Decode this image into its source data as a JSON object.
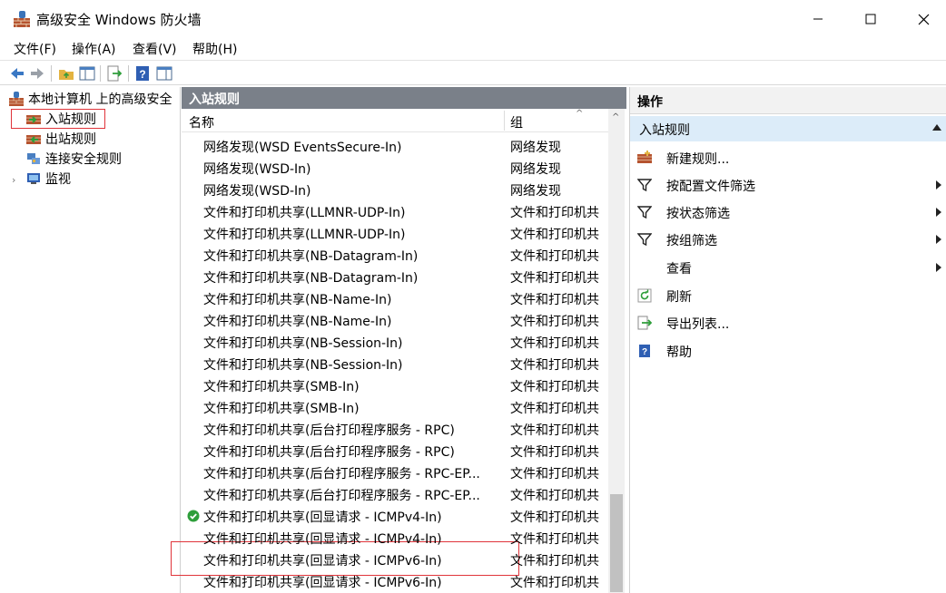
{
  "window": {
    "title": "高级安全 Windows 防火墙"
  },
  "menu": [
    "文件(F)",
    "操作(A)",
    "查看(V)",
    "帮助(H)"
  ],
  "tree": {
    "root": "本地计算机 上的高级安全",
    "items": [
      {
        "label": "入站规则",
        "icon": "inbound-rules-icon"
      },
      {
        "label": "出站规则",
        "icon": "outbound-rules-icon"
      },
      {
        "label": "连接安全规则",
        "icon": "connection-security-icon"
      },
      {
        "label": "监视",
        "icon": "monitor-icon"
      }
    ]
  },
  "list": {
    "title": "入站规则",
    "col_name": "名称",
    "col_group": "组",
    "rows": [
      {
        "name": "网络发现(WSD EventsSecure-In)",
        "group": "网络发现",
        "enabled": false
      },
      {
        "name": "网络发现(WSD-In)",
        "group": "网络发现",
        "enabled": false
      },
      {
        "name": "网络发现(WSD-In)",
        "group": "网络发现",
        "enabled": false
      },
      {
        "name": "文件和打印机共享(LLMNR-UDP-In)",
        "group": "文件和打印机共",
        "enabled": false
      },
      {
        "name": "文件和打印机共享(LLMNR-UDP-In)",
        "group": "文件和打印机共",
        "enabled": false
      },
      {
        "name": "文件和打印机共享(NB-Datagram-In)",
        "group": "文件和打印机共",
        "enabled": false
      },
      {
        "name": "文件和打印机共享(NB-Datagram-In)",
        "group": "文件和打印机共",
        "enabled": false
      },
      {
        "name": "文件和打印机共享(NB-Name-In)",
        "group": "文件和打印机共",
        "enabled": false
      },
      {
        "name": "文件和打印机共享(NB-Name-In)",
        "group": "文件和打印机共",
        "enabled": false
      },
      {
        "name": "文件和打印机共享(NB-Session-In)",
        "group": "文件和打印机共",
        "enabled": false
      },
      {
        "name": "文件和打印机共享(NB-Session-In)",
        "group": "文件和打印机共",
        "enabled": false
      },
      {
        "name": "文件和打印机共享(SMB-In)",
        "group": "文件和打印机共",
        "enabled": false
      },
      {
        "name": "文件和打印机共享(SMB-In)",
        "group": "文件和打印机共",
        "enabled": false
      },
      {
        "name": "文件和打印机共享(后台打印程序服务 - RPC)",
        "group": "文件和打印机共",
        "enabled": false
      },
      {
        "name": "文件和打印机共享(后台打印程序服务 - RPC)",
        "group": "文件和打印机共",
        "enabled": false
      },
      {
        "name": "文件和打印机共享(后台打印程序服务 - RPC-EP...",
        "group": "文件和打印机共",
        "enabled": false
      },
      {
        "name": "文件和打印机共享(后台打印程序服务 - RPC-EP...",
        "group": "文件和打印机共",
        "enabled": false
      },
      {
        "name": "文件和打印机共享(回显请求 - ICMPv4-In)",
        "group": "文件和打印机共",
        "enabled": true
      },
      {
        "name": "文件和打印机共享(回显请求 - ICMPv4-In)",
        "group": "文件和打印机共",
        "enabled": false
      },
      {
        "name": "文件和打印机共享(回显请求 - ICMPv6-In)",
        "group": "文件和打印机共",
        "enabled": false
      },
      {
        "name": "文件和打印机共享(回显请求 - ICMPv6-In)",
        "group": "文件和打印机共",
        "enabled": false
      }
    ]
  },
  "actions": {
    "title": "操作",
    "section": "入站规则",
    "items": [
      {
        "label": "新建规则...",
        "icon": "new-rule-icon",
        "submenu": false
      },
      {
        "label": "按配置文件筛选",
        "icon": "filter-icon",
        "submenu": true
      },
      {
        "label": "按状态筛选",
        "icon": "filter-icon",
        "submenu": true
      },
      {
        "label": "按组筛选",
        "icon": "filter-icon",
        "submenu": true
      },
      {
        "label": "查看",
        "icon": "",
        "submenu": true
      },
      {
        "label": "刷新",
        "icon": "refresh-icon",
        "submenu": false
      },
      {
        "label": "导出列表...",
        "icon": "export-list-icon",
        "submenu": false
      },
      {
        "label": "帮助",
        "icon": "help-icon",
        "submenu": false
      }
    ]
  },
  "colors": {
    "pane_header": "#7a8089",
    "selection_box": "#e0343a",
    "action_section": "#dcecf9",
    "enabled_check": "#2e9e3a"
  }
}
